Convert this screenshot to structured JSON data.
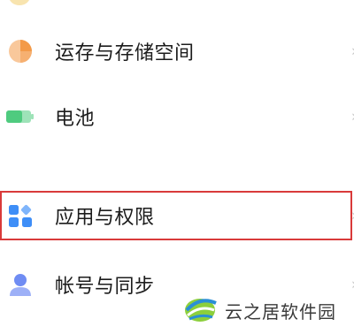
{
  "settings": {
    "items": [
      {
        "label": "运存与存储空间",
        "icon": "storage-pie-icon"
      },
      {
        "label": "电池",
        "icon": "battery-icon"
      },
      {
        "label": "应用与权限",
        "icon": "apps-grid-icon"
      },
      {
        "label": "帐号与同步",
        "icon": "account-person-icon"
      }
    ],
    "chevron": "›"
  },
  "watermark": {
    "text": "云之居软件园",
    "icon": "logo-icon"
  },
  "colors": {
    "highlight_border": "#d93a3a",
    "storage_icon": "#f5a65b",
    "battery_icon": "#5bd08a",
    "apps_icon": "#3e8ef7",
    "account_icon": "#5f7cf0"
  }
}
